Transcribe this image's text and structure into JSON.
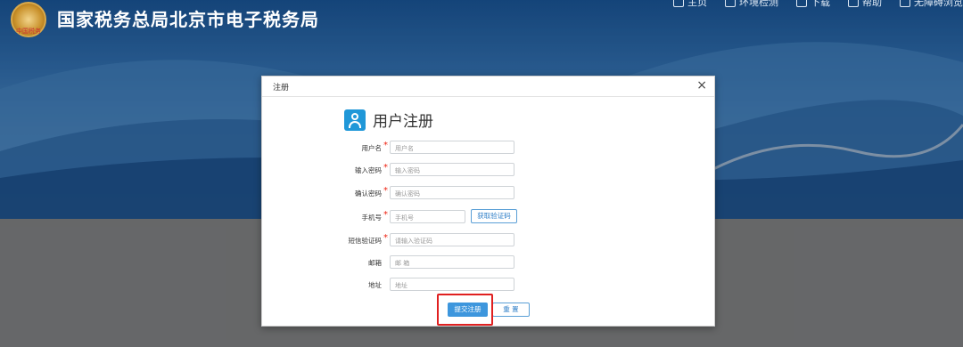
{
  "header": {
    "logo_text": "中国税务",
    "site_title": "国家税务总局北京市电子税务局",
    "nav": [
      {
        "label": "主页",
        "icon": "home-icon"
      },
      {
        "label": "环境检测",
        "icon": "environment-check-icon"
      },
      {
        "label": "下载",
        "icon": "download-icon"
      },
      {
        "label": "帮助",
        "icon": "help-icon"
      },
      {
        "label": "无障碍浏览",
        "icon": "accessibility-icon"
      }
    ]
  },
  "modal": {
    "title": "注册",
    "close": "×",
    "heading": "用户注册",
    "fields": [
      {
        "label": "用户名",
        "placeholder": "用户名",
        "required": true
      },
      {
        "label": "输入密码",
        "placeholder": "输入密码",
        "required": true
      },
      {
        "label": "确认密码",
        "placeholder": "确认密码",
        "required": true
      },
      {
        "label": "手机号",
        "placeholder": "手机号",
        "required": true
      },
      {
        "label": "短信验证码",
        "placeholder": "请输入验证码",
        "required": true
      },
      {
        "label": "邮箱",
        "placeholder": "邮 箱",
        "required": false
      },
      {
        "label": "地址",
        "placeholder": "地址",
        "required": false
      }
    ],
    "get_code_button": "获取验证码",
    "submit_button": "提交注册",
    "reset_button": "重 置",
    "required_mark": "*"
  },
  "colors": {
    "primary": "#3d96dd",
    "required": "#e21111",
    "highlight": "#e02020"
  }
}
